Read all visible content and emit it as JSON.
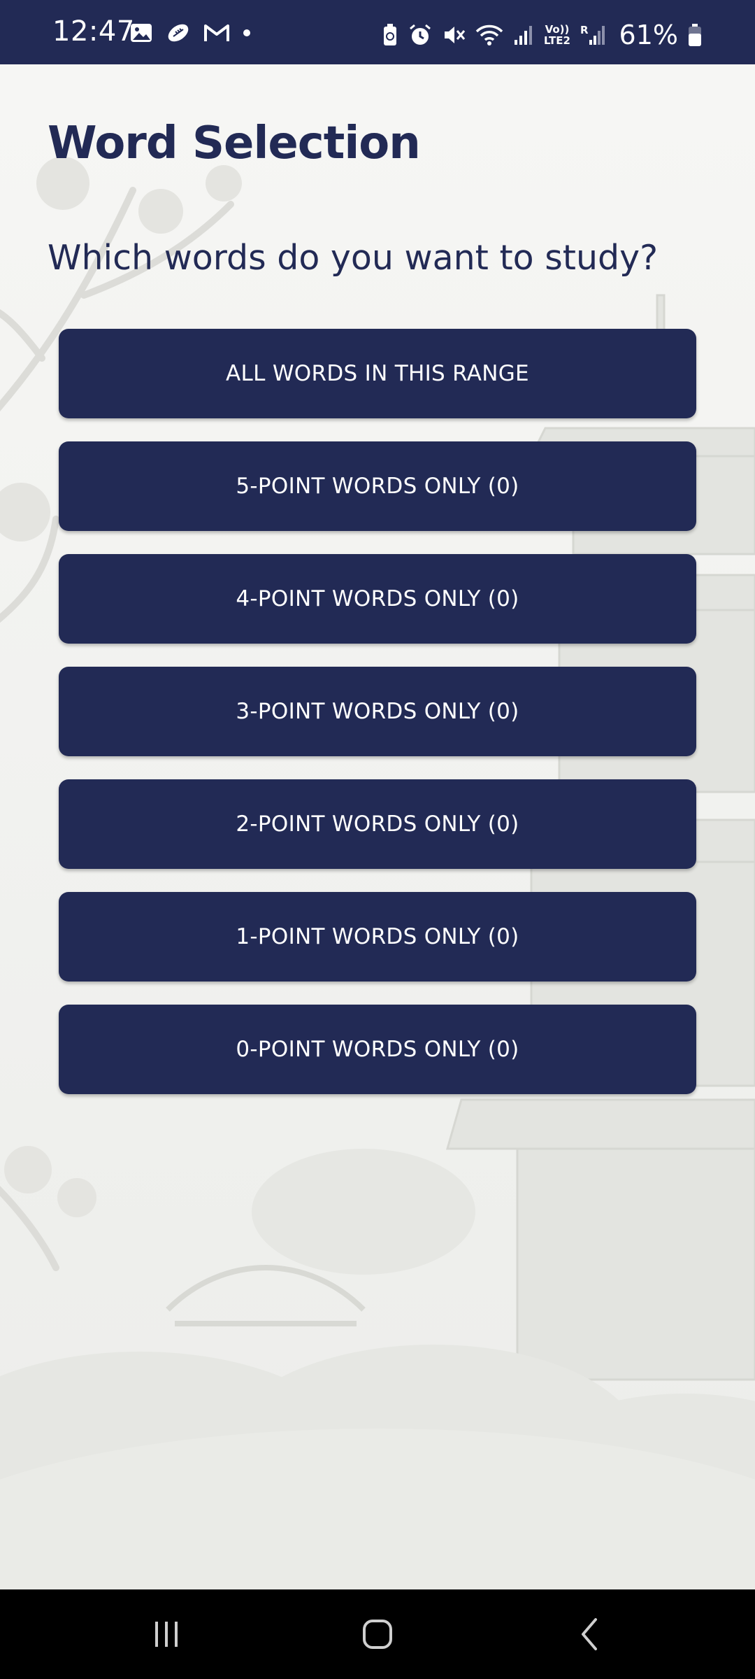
{
  "status_bar": {
    "time": "12:47",
    "battery_percent": "61%",
    "network_label_top": "Vo))",
    "network_label_bottom": "LTE2",
    "roaming_label": "R",
    "icons_left": [
      "gallery-icon",
      "football-icon",
      "gmail-icon",
      "dot-icon"
    ],
    "icons_right": [
      "battery-saver-icon",
      "alarm-icon",
      "mute-icon",
      "wifi-icon",
      "signal-icon",
      "signal-icon-2",
      "battery-icon"
    ]
  },
  "page": {
    "title": "Word Selection",
    "prompt": "Which words do you want to study?"
  },
  "options": [
    {
      "label": "ALL WORDS IN THIS RANGE"
    },
    {
      "label": "5-POINT WORDS ONLY (0)"
    },
    {
      "label": "4-POINT WORDS ONLY (0)"
    },
    {
      "label": "3-POINT WORDS ONLY (0)"
    },
    {
      "label": "2-POINT WORDS ONLY (0)"
    },
    {
      "label": "1-POINT WORDS ONLY (0)"
    },
    {
      "label": "0-POINT WORDS ONLY (0)"
    }
  ],
  "nav_bar": {
    "buttons": [
      "recents-icon",
      "home-icon",
      "back-icon"
    ]
  },
  "colors": {
    "primary": "#222a55",
    "background": "#f4f4f2",
    "button_text": "#ffffff"
  }
}
